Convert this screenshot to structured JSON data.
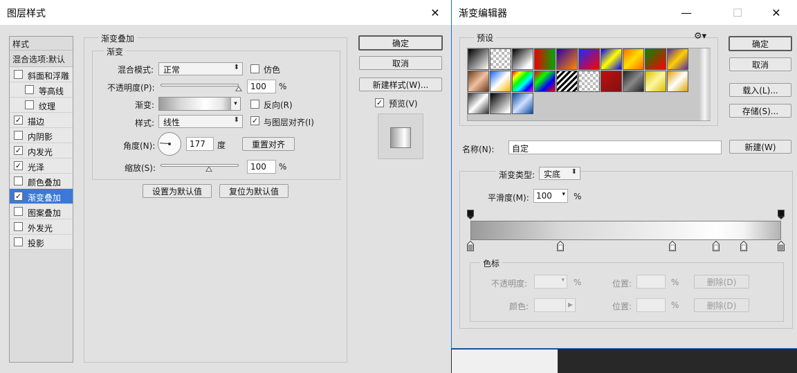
{
  "layer_style": {
    "title": "图层样式",
    "sidebar": {
      "header": "样式",
      "blend_options": "混合选项:默认",
      "items": [
        {
          "label": "斜面和浮雕",
          "checked": false,
          "indent": false
        },
        {
          "label": "等高线",
          "checked": false,
          "indent": true
        },
        {
          "label": "纹理",
          "checked": false,
          "indent": true
        },
        {
          "label": "描边",
          "checked": true,
          "indent": false
        },
        {
          "label": "内阴影",
          "checked": false,
          "indent": false
        },
        {
          "label": "内发光",
          "checked": true,
          "indent": false
        },
        {
          "label": "光泽",
          "checked": true,
          "indent": false
        },
        {
          "label": "颜色叠加",
          "checked": false,
          "indent": false
        },
        {
          "label": "渐变叠加",
          "checked": true,
          "indent": false,
          "selected": true
        },
        {
          "label": "图案叠加",
          "checked": false,
          "indent": false
        },
        {
          "label": "外发光",
          "checked": false,
          "indent": false
        },
        {
          "label": "投影",
          "checked": false,
          "indent": false
        }
      ]
    },
    "panel": {
      "group_title": "渐变叠加",
      "sub_title": "渐变",
      "blend_mode_label": "混合模式:",
      "blend_mode_value": "正常",
      "dither_label": "仿色",
      "dither_checked": false,
      "opacity_label": "不透明度(P):",
      "opacity_value": "100",
      "opacity_unit": "%",
      "opacity_level": 100,
      "gradient_label": "渐变:",
      "reverse_label": "反向(R)",
      "reverse_checked": false,
      "style_label": "样式:",
      "style_value": "线性",
      "align_label": "与图层对齐(I)",
      "align_checked": true,
      "angle_label": "角度(N):",
      "angle_value": "177",
      "angle_degrees": 177,
      "angle_unit": "度",
      "reset_align": "重置对齐",
      "scale_label": "缩放(S):",
      "scale_value": "100",
      "scale_unit": "%",
      "scale_level_fraction": 0.62,
      "set_default": "设置为默认值",
      "reset_default": "复位为默认值"
    },
    "buttons": {
      "ok": "确定",
      "cancel": "取消",
      "new_style": "新建样式(W)...",
      "preview": "预览(V)",
      "preview_checked": true
    }
  },
  "gradient_editor": {
    "title": "渐变编辑器",
    "presets_label": "预设",
    "name_label": "名称(N):",
    "name_value": "自定",
    "new_button": "新建(W)",
    "buttons": {
      "ok": "确定",
      "cancel": "取消",
      "load": "载入(L)...",
      "save": "存储(S)..."
    },
    "gradient_type_label": "渐变类型:",
    "gradient_type_value": "实底",
    "smoothness_label": "平滑度(M):",
    "smoothness_value": "100",
    "smoothness_unit": "%",
    "stops_group": "色标",
    "stop_opacity_label": "不透明度:",
    "stop_opacity_unit": "%",
    "location_label": "位置:",
    "location_unit": "%",
    "delete_label": "删除(D)",
    "color_label": "颜色:",
    "opacity_stop_positions": [
      0,
      100
    ],
    "color_stop_positions": [
      0,
      29,
      65,
      79,
      88,
      100
    ],
    "colors": {
      "gradient_dark": "#9a9a9a",
      "gradient_light": "#ffffff",
      "gradient_mid": "#e8e8e8"
    }
  }
}
